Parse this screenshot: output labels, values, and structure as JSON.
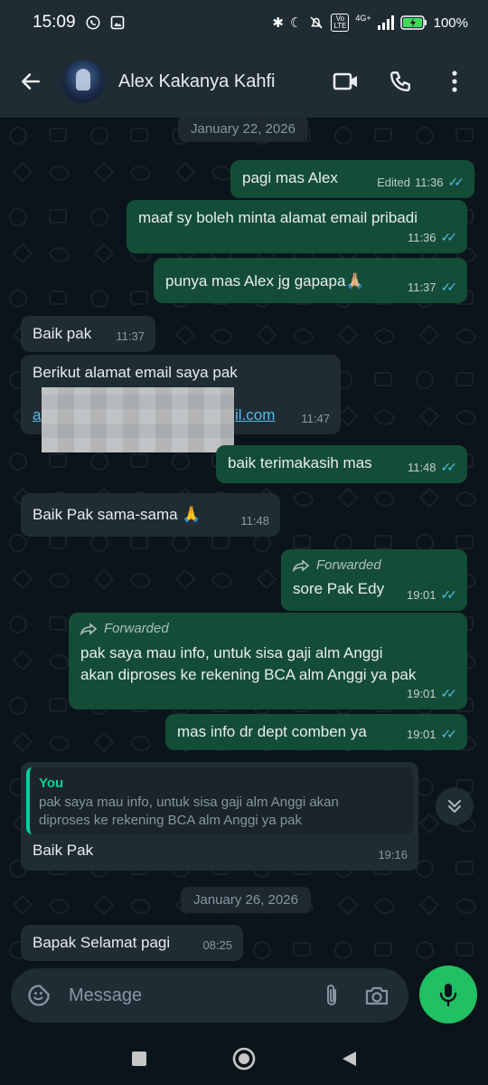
{
  "status_bar": {
    "time": "15:09",
    "network": "4G+",
    "volte": "Vo LTE",
    "battery": "100%"
  },
  "header": {
    "contact_name": "Alex Kakanya Kahfi"
  },
  "chat": {
    "dates": [
      "January 22, 2026",
      "January 26, 2026"
    ],
    "messages": [
      {
        "text": "pagi mas Alex",
        "edited": "Edited",
        "time": "11:36"
      },
      {
        "text": "maaf sy boleh minta alamat email pribadi",
        "time": "11:36"
      },
      {
        "text": "punya mas Alex jg gapapa🙏🏼",
        "time": "11:37"
      },
      {
        "text": "Baik pak",
        "time": "11:37"
      },
      {
        "text": "Berikut alamat email saya pak",
        "link_start": "a",
        "link_end": "il.com",
        "time": "11:47"
      },
      {
        "text": "baik terimakasih mas",
        "time": "11:48"
      },
      {
        "text": "Baik Pak sama-sama 🙏",
        "time": "11:48"
      },
      {
        "forwarded": "Forwarded",
        "text": "sore Pak Edy",
        "time": "19:01"
      },
      {
        "forwarded": "Forwarded",
        "text_line1": "pak saya mau info, untuk sisa gaji alm Anggi",
        "text_line2": "akan diproses ke rekening BCA alm Anggi ya pak",
        "time": "19:01"
      },
      {
        "text": "mas info dr dept comben ya",
        "time": "19:01"
      },
      {
        "quote_name": "You",
        "quote_line1": "pak saya mau info, untuk sisa gaji alm Anggi akan",
        "quote_line2": "diproses ke rekening BCA alm Anggi ya pak",
        "text": "Baik Pak",
        "time": "19:16"
      },
      {
        "text": "Bapak Selamat pagi",
        "time": "08:25"
      }
    ]
  },
  "input": {
    "placeholder": "Message"
  },
  "colors": {
    "outgoing": "#144d37",
    "incoming": "#202c33",
    "accent": "#21c063",
    "ticks": "#53bdeb"
  }
}
